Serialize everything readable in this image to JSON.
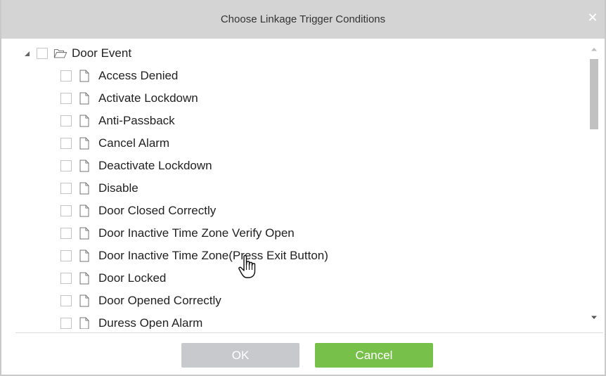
{
  "dialog": {
    "title": "Choose Linkage Trigger Conditions",
    "close_glyph": "✕"
  },
  "tree": {
    "root": {
      "label": "Door Event",
      "expanded": true,
      "checked": false,
      "icon": "folder-open-icon"
    },
    "items": [
      {
        "label": "Access Denied",
        "checked": false,
        "icon": "file-icon"
      },
      {
        "label": "Activate Lockdown",
        "checked": false,
        "icon": "file-icon"
      },
      {
        "label": "Anti-Passback",
        "checked": false,
        "icon": "file-icon"
      },
      {
        "label": "Cancel Alarm",
        "checked": false,
        "icon": "file-icon"
      },
      {
        "label": "Deactivate Lockdown",
        "checked": false,
        "icon": "file-icon"
      },
      {
        "label": "Disable",
        "checked": false,
        "icon": "file-icon"
      },
      {
        "label": "Door Closed Correctly",
        "checked": false,
        "icon": "file-icon"
      },
      {
        "label": "Door Inactive Time Zone Verify Open",
        "checked": false,
        "icon": "file-icon"
      },
      {
        "label": "Door Inactive Time Zone(Press Exit Button)",
        "checked": false,
        "icon": "file-icon"
      },
      {
        "label": "Door Locked",
        "checked": false,
        "icon": "file-icon"
      },
      {
        "label": "Door Opened Correctly",
        "checked": false,
        "icon": "file-icon"
      },
      {
        "label": "Duress Open Alarm",
        "checked": false,
        "icon": "file-icon"
      }
    ]
  },
  "buttons": {
    "ok_label": "OK",
    "cancel_label": "Cancel"
  },
  "colors": {
    "titlebar": "#d4d4d4",
    "ok_disabled": "#c7c9cc",
    "cancel": "#77c04a"
  }
}
